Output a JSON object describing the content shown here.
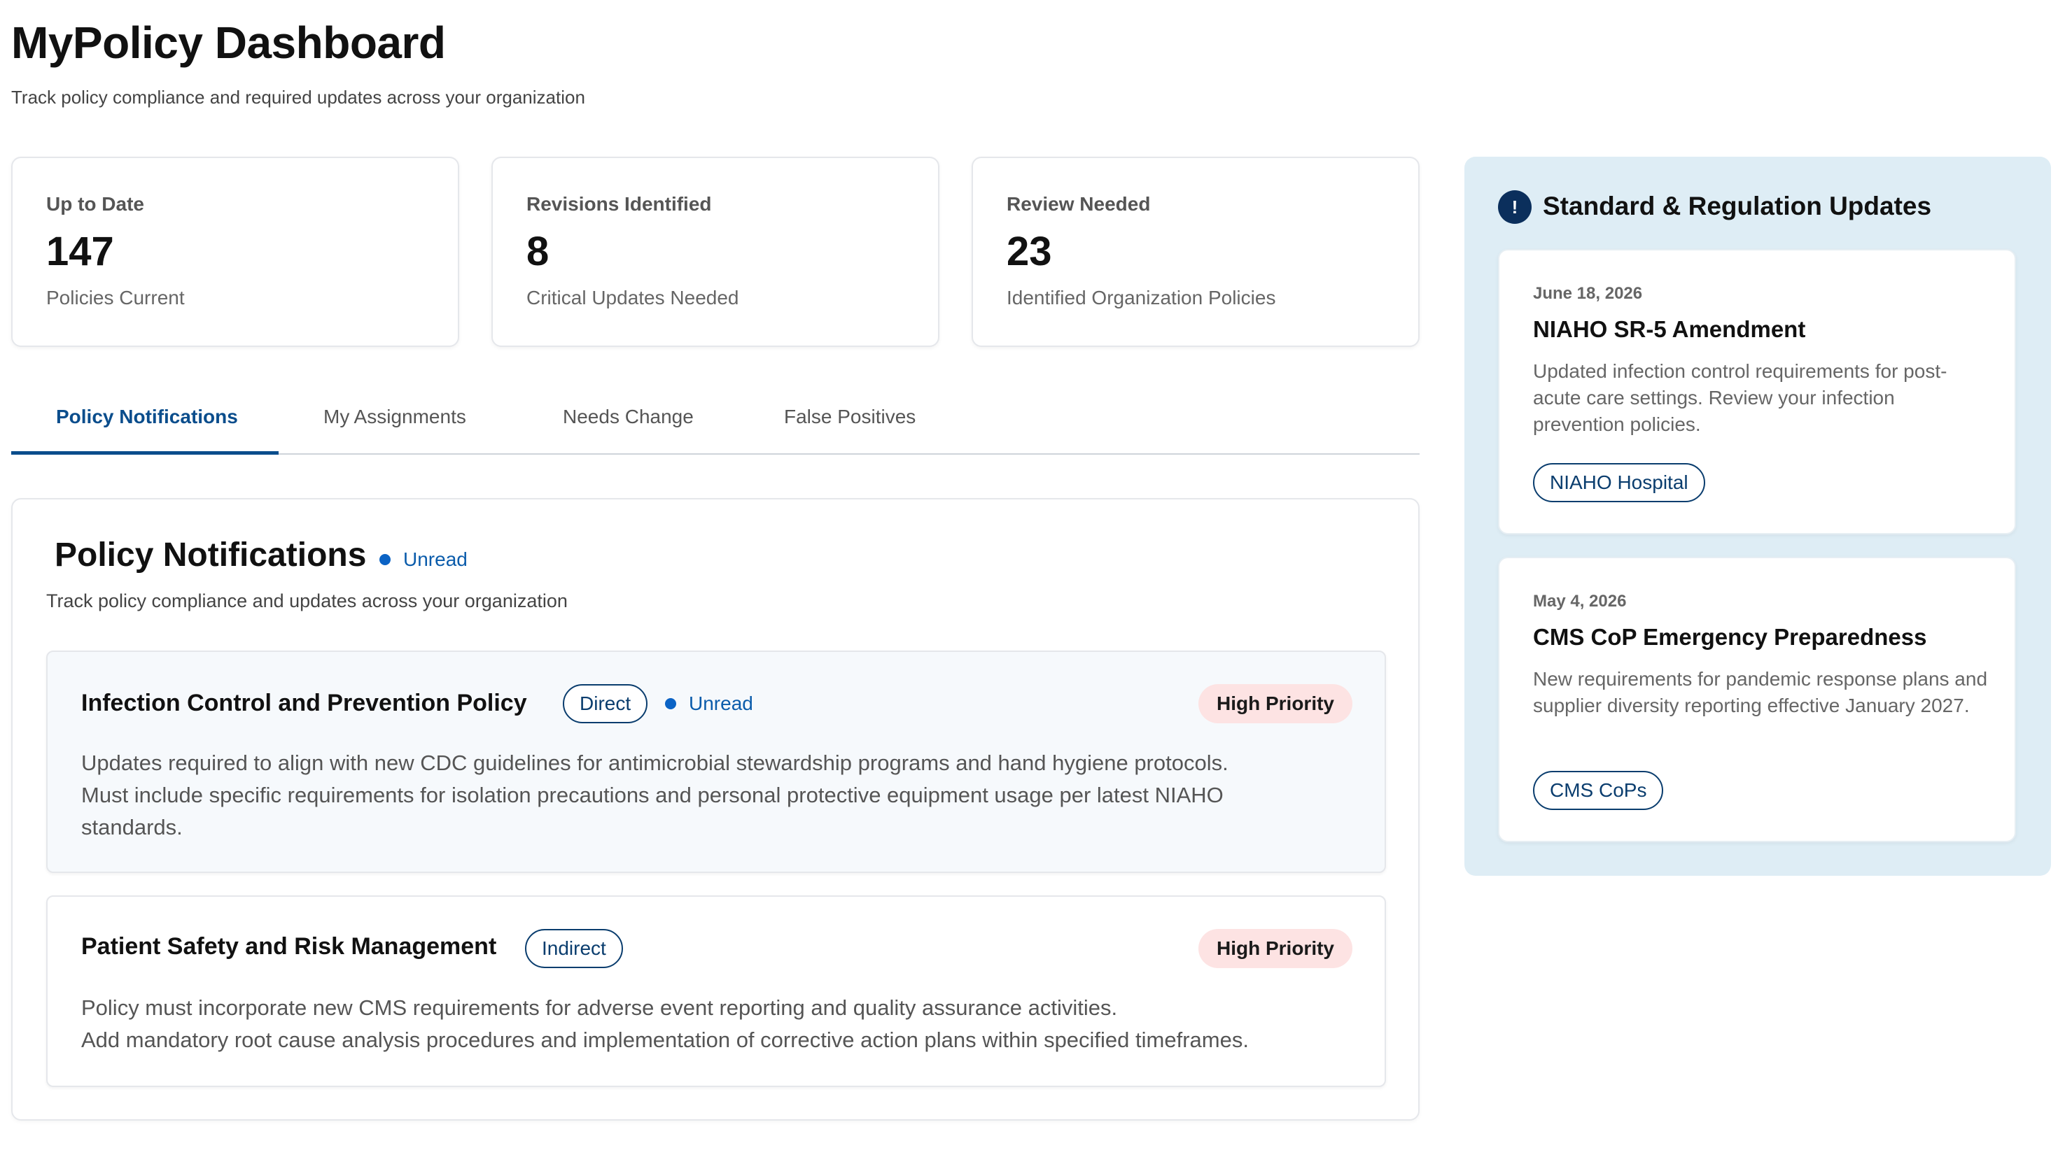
{
  "header": {
    "title": "MyPolicy Dashboard",
    "subtitle": "Track policy compliance and required updates across your organization"
  },
  "stats": [
    {
      "label": "Up to Date",
      "value": "147",
      "desc": "Policies Current"
    },
    {
      "label": "Revisions Identified",
      "value": "8",
      "desc": "Critical Updates Needed"
    },
    {
      "label": "Review Needed",
      "value": "23",
      "desc": "Identified Organization Policies"
    }
  ],
  "tabs": [
    {
      "label": "Policy Notifications",
      "active": true
    },
    {
      "label": "My Assignments",
      "active": false
    },
    {
      "label": "Needs Change",
      "active": false
    },
    {
      "label": "False Positives",
      "active": false
    }
  ],
  "notifications": {
    "title": "Policy Notifications",
    "unread_label": "Unread",
    "subtitle": "Track policy compliance and updates across your organization",
    "items": [
      {
        "title": "Infection Control and Prevention Policy",
        "type": "Direct",
        "status": "Unread",
        "priority": "High Priority",
        "body_lines": [
          "Updates required to align with new CDC guidelines for antimicrobial stewardship programs and hand hygiene protocols.",
          "Must include specific requirements for isolation precautions and personal protective equipment usage per latest NIAHO",
          "standards."
        ]
      },
      {
        "title": "Patient Safety and Risk Management",
        "type": "Indirect",
        "priority": "High Priority",
        "body_lines": [
          "Policy must incorporate new CMS requirements for adverse event reporting and quality assurance activities.",
          "Add mandatory root cause analysis procedures and implementation of corrective action plans within specified timeframes."
        ]
      }
    ]
  },
  "side_panel": {
    "icon": "alert-icon",
    "icon_glyph": "!",
    "title": "Standard & Regulation Updates",
    "updates": [
      {
        "date": "June 18, 2026",
        "title": "NIAHO SR-5 Amendment",
        "body": "Updated infection control requirements for post-acute care settings. Review your infection prevention policies.",
        "tag": "NIAHO Hospital"
      },
      {
        "date": "May 4, 2026",
        "title": "CMS CoP Emergency Preparedness",
        "body": "New requirements for pandemic response plans and supplier diversity reporting effective January 2027.",
        "tag": "CMS CoPs"
      }
    ]
  },
  "colors": {
    "accent": "#0a4d8c",
    "unread_dot": "#0b63c5",
    "priority_bg": "#fde3e3",
    "side_panel_bg": "#deedf5"
  }
}
